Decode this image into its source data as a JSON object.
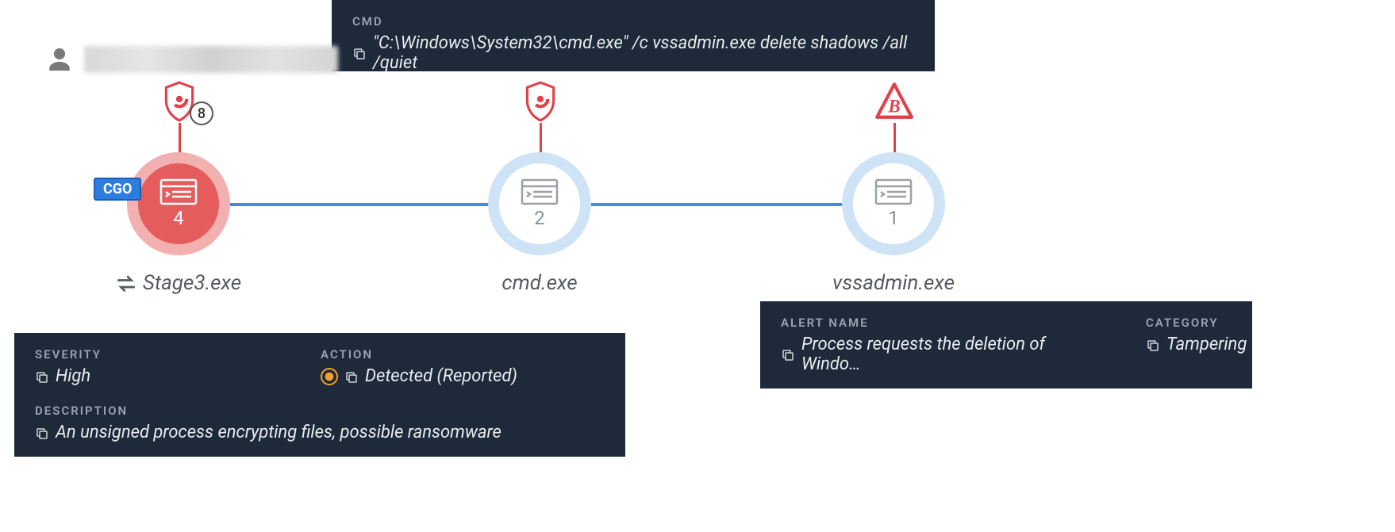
{
  "cmd_panel": {
    "label": "CMD",
    "value": "\"C:\\Windows\\System32\\cmd.exe\" /c vssadmin.exe delete shadows /all /quiet"
  },
  "user": {
    "name_redacted": true
  },
  "nodes": [
    {
      "id": "stage3",
      "label": "Stage3.exe",
      "count": "4",
      "variant": "red",
      "has_swap_icon": true,
      "cgo_tag": "CGO",
      "shield_count": "8"
    },
    {
      "id": "cmd",
      "label": "cmd.exe",
      "count": "2",
      "variant": "blue"
    },
    {
      "id": "vss",
      "label": "vssadmin.exe",
      "count": "1",
      "variant": "blue",
      "triangle_letter": "B"
    }
  ],
  "detail_panel": {
    "severity_label": "SEVERITY",
    "severity_value": "High",
    "action_label": "ACTION",
    "action_value": "Detected (Reported)",
    "description_label": "DESCRIPTION",
    "description_value": "An unsigned process encrypting files, possible ransomware"
  },
  "alert_panel": {
    "name_label": "ALERT NAME",
    "name_value": "Process requests the deletion of Windo…",
    "category_label": "CATEGORY",
    "category_value": "Tampering"
  }
}
